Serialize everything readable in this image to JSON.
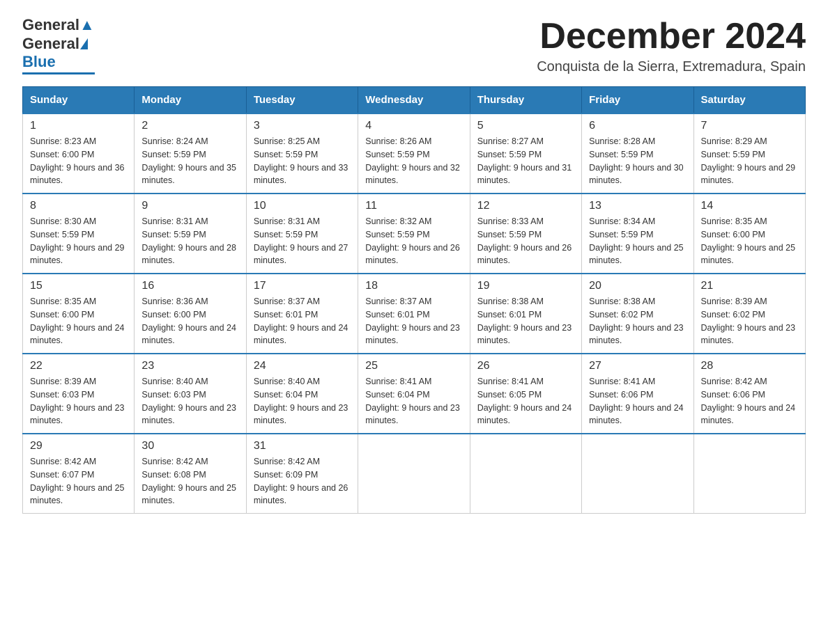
{
  "logo": {
    "text_general": "General",
    "text_blue": "Blue"
  },
  "header": {
    "month": "December 2024",
    "location": "Conquista de la Sierra, Extremadura, Spain"
  },
  "days_of_week": [
    "Sunday",
    "Monday",
    "Tuesday",
    "Wednesday",
    "Thursday",
    "Friday",
    "Saturday"
  ],
  "weeks": [
    [
      {
        "day": "1",
        "sunrise": "8:23 AM",
        "sunset": "6:00 PM",
        "daylight": "9 hours and 36 minutes."
      },
      {
        "day": "2",
        "sunrise": "8:24 AM",
        "sunset": "5:59 PM",
        "daylight": "9 hours and 35 minutes."
      },
      {
        "day": "3",
        "sunrise": "8:25 AM",
        "sunset": "5:59 PM",
        "daylight": "9 hours and 33 minutes."
      },
      {
        "day": "4",
        "sunrise": "8:26 AM",
        "sunset": "5:59 PM",
        "daylight": "9 hours and 32 minutes."
      },
      {
        "day": "5",
        "sunrise": "8:27 AM",
        "sunset": "5:59 PM",
        "daylight": "9 hours and 31 minutes."
      },
      {
        "day": "6",
        "sunrise": "8:28 AM",
        "sunset": "5:59 PM",
        "daylight": "9 hours and 30 minutes."
      },
      {
        "day": "7",
        "sunrise": "8:29 AM",
        "sunset": "5:59 PM",
        "daylight": "9 hours and 29 minutes."
      }
    ],
    [
      {
        "day": "8",
        "sunrise": "8:30 AM",
        "sunset": "5:59 PM",
        "daylight": "9 hours and 29 minutes."
      },
      {
        "day": "9",
        "sunrise": "8:31 AM",
        "sunset": "5:59 PM",
        "daylight": "9 hours and 28 minutes."
      },
      {
        "day": "10",
        "sunrise": "8:31 AM",
        "sunset": "5:59 PM",
        "daylight": "9 hours and 27 minutes."
      },
      {
        "day": "11",
        "sunrise": "8:32 AM",
        "sunset": "5:59 PM",
        "daylight": "9 hours and 26 minutes."
      },
      {
        "day": "12",
        "sunrise": "8:33 AM",
        "sunset": "5:59 PM",
        "daylight": "9 hours and 26 minutes."
      },
      {
        "day": "13",
        "sunrise": "8:34 AM",
        "sunset": "5:59 PM",
        "daylight": "9 hours and 25 minutes."
      },
      {
        "day": "14",
        "sunrise": "8:35 AM",
        "sunset": "6:00 PM",
        "daylight": "9 hours and 25 minutes."
      }
    ],
    [
      {
        "day": "15",
        "sunrise": "8:35 AM",
        "sunset": "6:00 PM",
        "daylight": "9 hours and 24 minutes."
      },
      {
        "day": "16",
        "sunrise": "8:36 AM",
        "sunset": "6:00 PM",
        "daylight": "9 hours and 24 minutes."
      },
      {
        "day": "17",
        "sunrise": "8:37 AM",
        "sunset": "6:01 PM",
        "daylight": "9 hours and 24 minutes."
      },
      {
        "day": "18",
        "sunrise": "8:37 AM",
        "sunset": "6:01 PM",
        "daylight": "9 hours and 23 minutes."
      },
      {
        "day": "19",
        "sunrise": "8:38 AM",
        "sunset": "6:01 PM",
        "daylight": "9 hours and 23 minutes."
      },
      {
        "day": "20",
        "sunrise": "8:38 AM",
        "sunset": "6:02 PM",
        "daylight": "9 hours and 23 minutes."
      },
      {
        "day": "21",
        "sunrise": "8:39 AM",
        "sunset": "6:02 PM",
        "daylight": "9 hours and 23 minutes."
      }
    ],
    [
      {
        "day": "22",
        "sunrise": "8:39 AM",
        "sunset": "6:03 PM",
        "daylight": "9 hours and 23 minutes."
      },
      {
        "day": "23",
        "sunrise": "8:40 AM",
        "sunset": "6:03 PM",
        "daylight": "9 hours and 23 minutes."
      },
      {
        "day": "24",
        "sunrise": "8:40 AM",
        "sunset": "6:04 PM",
        "daylight": "9 hours and 23 minutes."
      },
      {
        "day": "25",
        "sunrise": "8:41 AM",
        "sunset": "6:04 PM",
        "daylight": "9 hours and 23 minutes."
      },
      {
        "day": "26",
        "sunrise": "8:41 AM",
        "sunset": "6:05 PM",
        "daylight": "9 hours and 24 minutes."
      },
      {
        "day": "27",
        "sunrise": "8:41 AM",
        "sunset": "6:06 PM",
        "daylight": "9 hours and 24 minutes."
      },
      {
        "day": "28",
        "sunrise": "8:42 AM",
        "sunset": "6:06 PM",
        "daylight": "9 hours and 24 minutes."
      }
    ],
    [
      {
        "day": "29",
        "sunrise": "8:42 AM",
        "sunset": "6:07 PM",
        "daylight": "9 hours and 25 minutes."
      },
      {
        "day": "30",
        "sunrise": "8:42 AM",
        "sunset": "6:08 PM",
        "daylight": "9 hours and 25 minutes."
      },
      {
        "day": "31",
        "sunrise": "8:42 AM",
        "sunset": "6:09 PM",
        "daylight": "9 hours and 26 minutes."
      },
      null,
      null,
      null,
      null
    ]
  ]
}
